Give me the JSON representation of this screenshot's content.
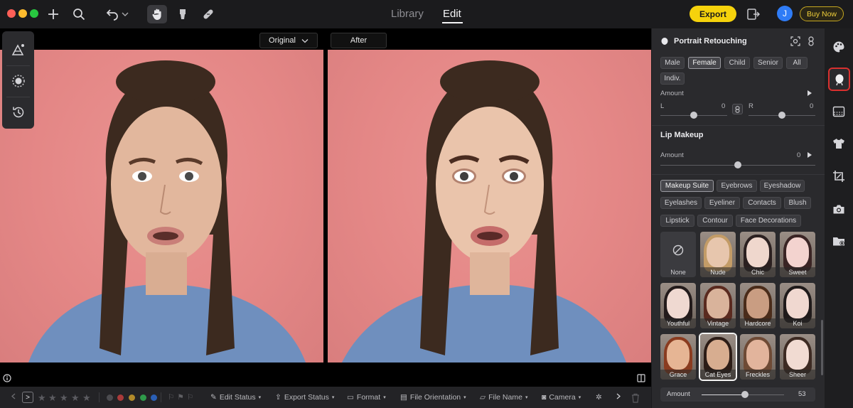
{
  "window": {
    "traffic_lights": [
      "#fe5f57",
      "#febc2e",
      "#28c840"
    ]
  },
  "toolbar": {
    "icons": [
      "plus-icon",
      "search-icon",
      "undo-icon",
      "chevron-down-icon",
      "hand-icon",
      "eraser-icon",
      "bandage-icon"
    ],
    "tab_library": "Library",
    "tab_edit": "Edit",
    "export_label": "Export",
    "avatar_initial": "J",
    "buy_now_label": "Buy Now"
  },
  "compare": {
    "original_label": "Original",
    "after_label": "After"
  },
  "bottom": {
    "labels": [
      ">",
      "Edit Status",
      "Export Status",
      "Format",
      "File Orientation",
      "File Name",
      "Camera"
    ],
    "stars": 5,
    "color_tags": [
      "#a93a3a",
      "#b18a2a",
      "#2f9a4a",
      "#2a5fb5"
    ]
  },
  "panel": {
    "title": "Portrait Retouching",
    "gender_chips": [
      "Male",
      "Female",
      "Child",
      "Senior",
      "All",
      "Indiv."
    ],
    "gender_selected": "Female",
    "amount_label": "Amount",
    "l_label": "L",
    "l_value": "0",
    "r_label": "R",
    "r_value": "0",
    "lip_title": "Lip Makeup",
    "lip_amount_label": "Amount",
    "lip_amount_value": "0",
    "makeup_chips_row1": [
      "Makeup Suite",
      "Eyebrows",
      "Eyeshadow"
    ],
    "makeup_chips_row2": [
      "Eyelashes",
      "Eyeliner",
      "Contacts",
      "Blush"
    ],
    "makeup_chips_row3": [
      "Lipstick",
      "Contour",
      "Face Decorations"
    ],
    "makeup_selected": "Makeup Suite",
    "presets": [
      {
        "name": "None",
        "tone": "#3b3b3f",
        "hair": "#3b3b3f"
      },
      {
        "name": "Nude",
        "tone": "#e7c6ad",
        "hair": "#c39c67"
      },
      {
        "name": "Chic",
        "tone": "#efd7cd",
        "hair": "#2b2020"
      },
      {
        "name": "Sweet",
        "tone": "#f3d3cf",
        "hair": "#3a2424"
      },
      {
        "name": "Youthful",
        "tone": "#efd9d1",
        "hair": "#231b1b"
      },
      {
        "name": "Vintage",
        "tone": "#d9b39b",
        "hair": "#5a2a1f"
      },
      {
        "name": "Hardcore",
        "tone": "#c99d82",
        "hair": "#4a2c1a"
      },
      {
        "name": "Koi",
        "tone": "#f0d8d0",
        "hair": "#1f1a1a"
      },
      {
        "name": "Grace",
        "tone": "#e6b594",
        "hair": "#8a3c20"
      },
      {
        "name": "Cat Eyes",
        "tone": "#d7ad90",
        "hair": "#2c1c16"
      },
      {
        "name": "Freckles",
        "tone": "#e2b49c",
        "hair": "#6e4a35"
      },
      {
        "name": "Sheer",
        "tone": "#f1dbd2",
        "hair": "#3d2a22"
      }
    ],
    "preset_selected": "Cat Eyes",
    "amount2_label": "Amount",
    "amount2_value": "53",
    "amount2_level": 0.53
  },
  "rail": {
    "icons": [
      "palette-icon",
      "portrait-retouch-icon",
      "background-icon",
      "shirt-icon",
      "crop-icon",
      "camera-icon",
      "folder-icon"
    ],
    "active": "portrait-retouch-icon"
  },
  "accent": "#f5d20c"
}
